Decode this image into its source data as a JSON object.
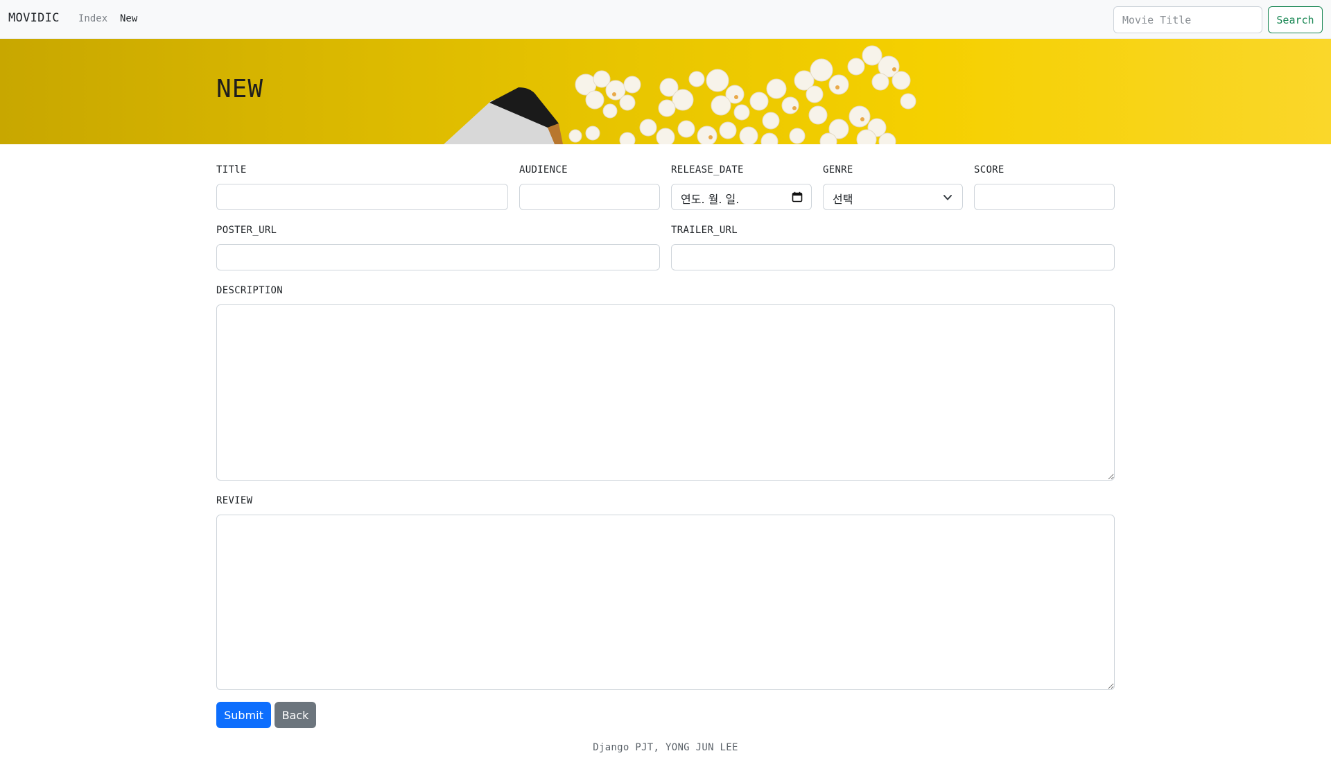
{
  "navbar": {
    "brand": "MOVIDIC",
    "links": [
      "Index",
      "New"
    ],
    "search": {
      "placeholder": "Movie Title",
      "button_label": "Search"
    }
  },
  "hero": {
    "title": "NEW"
  },
  "form": {
    "title_label": "TITlE",
    "audience_label": "AUDIENCE",
    "release_date_label": "RELEASE_DATE",
    "release_date_value": "연도. 월. 일.",
    "genre_label": "GENRE",
    "genre_selected": "선택",
    "score_label": "SCORE",
    "poster_url_label": "POSTER_URL",
    "trailer_url_label": "TRAILER_URL",
    "description_label": "DESCRIPTION",
    "review_label": "REVIEW",
    "submit_label": "Submit",
    "back_label": "Back"
  },
  "footer": {
    "text": "Django PJT, YONG JUN LEE"
  },
  "icons": {
    "calendar": "calendar-icon",
    "chevron": "chevron-down-icon",
    "resize": "resize-grip-icon"
  },
  "colors": {
    "search_accent": "#198754",
    "submit": "#0d6efd",
    "back": "#6c757d",
    "hero_yellow": "#f5d000"
  }
}
